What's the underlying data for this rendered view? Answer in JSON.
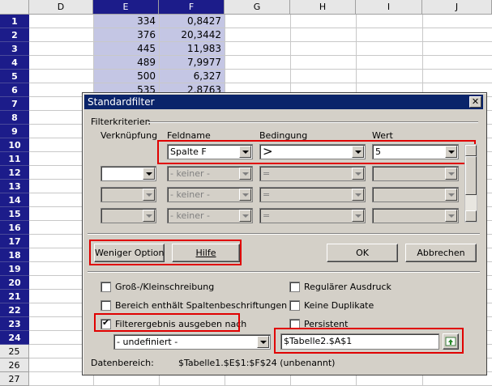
{
  "columns": [
    "D",
    "E",
    "F",
    "G",
    "H",
    "I",
    "J"
  ],
  "rows": [
    "1",
    "2",
    "3",
    "4",
    "5",
    "6",
    "7",
    "8",
    "9",
    "10",
    "11",
    "12",
    "13",
    "14",
    "15",
    "16",
    "17",
    "18",
    "19",
    "20",
    "21",
    "22",
    "23",
    "24",
    "25",
    "26",
    "27"
  ],
  "cells_e": [
    "334",
    "376",
    "445",
    "489",
    "500",
    "535"
  ],
  "cells_f": [
    "0,8427",
    "20,3442",
    "11,983",
    "7,9977",
    "6,327",
    "2,8763"
  ],
  "dialog": {
    "title": "Standardfilter",
    "close": "✕",
    "section_criteria": "Filterkriterien",
    "hdr_link": "Verknüpfung",
    "hdr_field": "Feldname",
    "hdr_cond": "Bedingung",
    "hdr_value": "Wert",
    "row1": {
      "link": "",
      "field": "Spalte F",
      "cond": ">",
      "value": "5"
    },
    "row2": {
      "link": "",
      "field": "- keiner -",
      "cond": "=",
      "value": ""
    },
    "row3": {
      "link": "",
      "field": "- keiner -",
      "cond": "=",
      "value": ""
    },
    "row4": {
      "link": "",
      "field": "- keiner -",
      "cond": "=",
      "value": ""
    },
    "btn_less": "Weniger Optionen",
    "btn_help": "Hilfe",
    "btn_ok": "OK",
    "btn_cancel": "Abbrechen",
    "opt_case": "Groß-/Kleinschreibung",
    "opt_header": "Bereich enthält Spaltenbeschriftungen",
    "opt_output": "Filterergebnis ausgeben nach",
    "opt_regex": "Regulärer Ausdruck",
    "opt_nodup": "Keine Duplikate",
    "opt_persist": "Persistent",
    "output_combo": "- undefiniert -",
    "output_ref": "$Tabelle2.$A$1",
    "range_label": "Datenbereich:",
    "range_value": "$Tabelle1.$E$1:$F$24 (unbenannt)"
  }
}
